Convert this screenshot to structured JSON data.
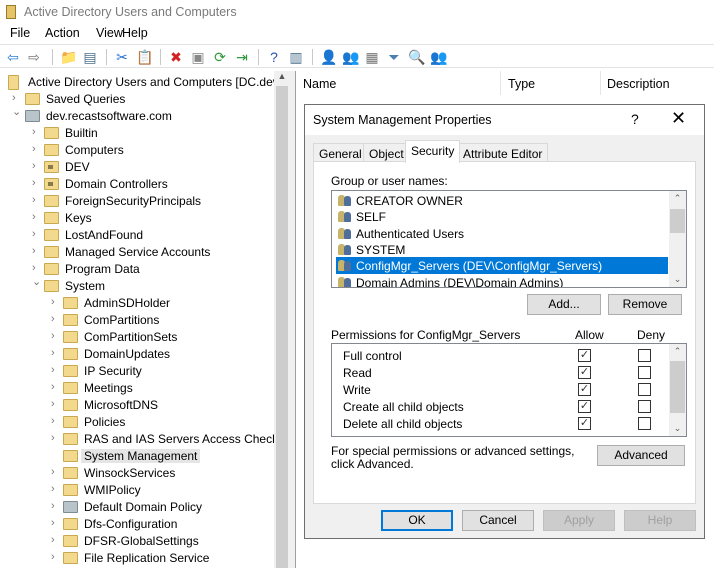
{
  "window": {
    "title": "Active Directory Users and Computers"
  },
  "menu": [
    "File",
    "Action",
    "View",
    "Help"
  ],
  "toolbar": [
    {
      "icon": "back-arrow-icon",
      "glyph": "⇦",
      "color": "#2a7fd4"
    },
    {
      "icon": "forward-arrow-icon",
      "glyph": "⇨",
      "color": "#777777"
    },
    {
      "icon": "up-folder-icon",
      "glyph": "📁",
      "color": "#d9a520"
    },
    {
      "icon": "show-hide-console-tree-icon",
      "glyph": "▤",
      "color": "#4a6f8a"
    },
    {
      "icon": "cut-icon",
      "glyph": "✂",
      "color": "#2a6fd0"
    },
    {
      "icon": "paste-icon",
      "glyph": "📋",
      "color": "#8a6d3b"
    },
    {
      "icon": "delete-icon",
      "glyph": "✖",
      "color": "#d42020"
    },
    {
      "icon": "properties-icon",
      "glyph": "▣",
      "color": "#888888"
    },
    {
      "icon": "refresh-icon",
      "glyph": "⟳",
      "color": "#2e9a3c"
    },
    {
      "icon": "export-list-icon",
      "glyph": "⇥",
      "color": "#2e9a3c"
    },
    {
      "icon": "help-icon",
      "glyph": "?",
      "color": "#2a4fb0"
    },
    {
      "icon": "show-action-pane-icon",
      "glyph": "▥",
      "color": "#4a6f8a"
    },
    {
      "icon": "new-user-icon",
      "glyph": "👤",
      "color": "#666666"
    },
    {
      "icon": "new-group-icon",
      "glyph": "👥",
      "color": "#666666"
    },
    {
      "icon": "new-ou-icon",
      "glyph": "▦",
      "color": "#777777"
    },
    {
      "icon": "filter-icon",
      "glyph": "⏷",
      "color": "#4a7fb0"
    },
    {
      "icon": "find-icon",
      "glyph": "🔍",
      "color": "#c9a94f"
    },
    {
      "icon": "add-to-group-icon",
      "glyph": "👥",
      "color": "#666666"
    }
  ],
  "tree": [
    {
      "label": "Active Directory Users and Computers [DC.dev",
      "level": 0,
      "icon": "console-root-icon",
      "expander": "none"
    },
    {
      "label": "Saved Queries",
      "level": 1,
      "icon": "folder-icon",
      "expander": "collapsed"
    },
    {
      "label": "dev.recastsoftware.com",
      "level": 1,
      "icon": "domain-icon",
      "expander": "expanded"
    },
    {
      "label": "Builtin",
      "level": 2,
      "icon": "folder-icon",
      "expander": "collapsed"
    },
    {
      "label": "Computers",
      "level": 2,
      "icon": "folder-icon",
      "expander": "collapsed"
    },
    {
      "label": "DEV",
      "level": 2,
      "icon": "ou-icon",
      "expander": "collapsed"
    },
    {
      "label": "Domain Controllers",
      "level": 2,
      "icon": "ou-icon",
      "expander": "collapsed"
    },
    {
      "label": "ForeignSecurityPrincipals",
      "level": 2,
      "icon": "folder-icon",
      "expander": "collapsed"
    },
    {
      "label": "Keys",
      "level": 2,
      "icon": "folder-icon",
      "expander": "collapsed"
    },
    {
      "label": "LostAndFound",
      "level": 2,
      "icon": "folder-icon",
      "expander": "collapsed"
    },
    {
      "label": "Managed Service Accounts",
      "level": 2,
      "icon": "folder-icon",
      "expander": "collapsed"
    },
    {
      "label": "Program Data",
      "level": 2,
      "icon": "folder-icon",
      "expander": "collapsed"
    },
    {
      "label": "System",
      "level": 2,
      "icon": "folder-icon",
      "expander": "expanded"
    },
    {
      "label": "AdminSDHolder",
      "level": 3,
      "icon": "folder-icon",
      "expander": "collapsed"
    },
    {
      "label": "ComPartitions",
      "level": 3,
      "icon": "folder-icon",
      "expander": "collapsed"
    },
    {
      "label": "ComPartitionSets",
      "level": 3,
      "icon": "folder-icon",
      "expander": "collapsed"
    },
    {
      "label": "DomainUpdates",
      "level": 3,
      "icon": "folder-icon",
      "expander": "collapsed"
    },
    {
      "label": "IP Security",
      "level": 3,
      "icon": "folder-icon",
      "expander": "collapsed"
    },
    {
      "label": "Meetings",
      "level": 3,
      "icon": "folder-icon",
      "expander": "collapsed"
    },
    {
      "label": "MicrosoftDNS",
      "level": 3,
      "icon": "folder-icon",
      "expander": "collapsed"
    },
    {
      "label": "Policies",
      "level": 3,
      "icon": "folder-icon",
      "expander": "collapsed"
    },
    {
      "label": "RAS and IAS Servers Access Check",
      "level": 3,
      "icon": "folder-icon",
      "expander": "collapsed"
    },
    {
      "label": "System Management",
      "level": 3,
      "icon": "folder-icon",
      "expander": "none",
      "selected": true
    },
    {
      "label": "WinsockServices",
      "level": 3,
      "icon": "folder-icon",
      "expander": "collapsed"
    },
    {
      "label": "WMIPolicy",
      "level": 3,
      "icon": "folder-icon",
      "expander": "collapsed"
    },
    {
      "label": "Default Domain Policy",
      "level": 3,
      "icon": "policy-icon",
      "expander": "collapsed"
    },
    {
      "label": "Dfs-Configuration",
      "level": 3,
      "icon": "folder-icon",
      "expander": "collapsed"
    },
    {
      "label": "DFSR-GlobalSettings",
      "level": 3,
      "icon": "folder-icon",
      "expander": "collapsed"
    },
    {
      "label": "File Replication Service",
      "level": 3,
      "icon": "frs-icon",
      "expander": "collapsed"
    }
  ],
  "list_columns": [
    "Name",
    "Type",
    "Description"
  ],
  "dialog": {
    "title": "System Management Properties",
    "help": "?",
    "close": "✕",
    "tabs": [
      {
        "label": "General"
      },
      {
        "label": "Object"
      },
      {
        "label": "Security",
        "active": true
      },
      {
        "label": "Attribute Editor"
      }
    ],
    "group_label": "Group or user names:",
    "users": [
      {
        "name": "CREATOR OWNER"
      },
      {
        "name": "SELF"
      },
      {
        "name": "Authenticated Users"
      },
      {
        "name": "SYSTEM"
      },
      {
        "name": "ConfigMgr_Servers (DEV\\ConfigMgr_Servers)",
        "selected": true
      },
      {
        "name": "Domain Admins (DEV\\Domain Admins)"
      }
    ],
    "add": "Add...",
    "remove": "Remove",
    "perm_label": "Permissions for ConfigMgr_Servers",
    "allow": "Allow",
    "deny": "Deny",
    "permissions": [
      {
        "name": "Full control",
        "allow": true,
        "deny": false
      },
      {
        "name": "Read",
        "allow": true,
        "deny": false
      },
      {
        "name": "Write",
        "allow": true,
        "deny": false
      },
      {
        "name": "Create all child objects",
        "allow": true,
        "deny": false
      },
      {
        "name": "Delete all child objects",
        "allow": true,
        "deny": false
      }
    ],
    "advanced_text": "For special permissions or advanced settings, click Advanced.",
    "advanced": "Advanced",
    "ok": "OK",
    "cancel": "Cancel",
    "apply": "Apply",
    "help_btn": "Help"
  },
  "colors": {
    "selection": "#0078d7",
    "tree_selection": "#e5e5e5",
    "folder": "#f3d98e"
  }
}
